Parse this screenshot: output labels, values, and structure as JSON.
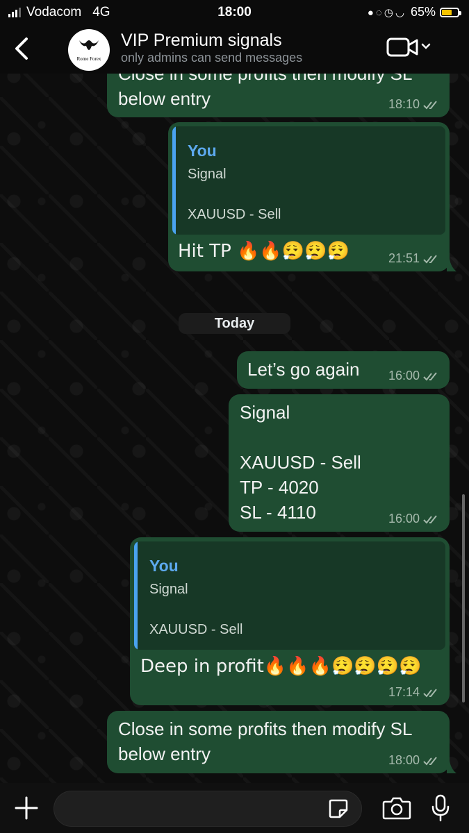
{
  "status_bar": {
    "carrier": "Vodacom",
    "network": "4G",
    "time": "18:00",
    "battery_percent": "65%",
    "battery_level": 0.65
  },
  "header": {
    "title": "VIP Premium signals",
    "subtitle": "only admins can send messages",
    "avatar_text": "Rome Forex"
  },
  "messages": [
    {
      "text": "Close in some profits then modify SL\nbelow entry",
      "time": "18:10"
    },
    {
      "quote_author": "You",
      "quote_line1": "Signal",
      "quote_line2": "XAUUSD - Sell",
      "text": "Hit TP 🔥🔥😮‍💨😮‍💨😮‍💨",
      "time": "21:51"
    },
    {
      "text": "Let’s go again",
      "time": "16:00"
    },
    {
      "text": "Signal\n\nXAUUSD - Sell\nTP - 4020\nSL - 4110",
      "time": "16:00"
    },
    {
      "quote_author": "You",
      "quote_line1": "Signal",
      "quote_line2": "XAUUSD - Sell",
      "text": "Deep in profit🔥🔥🔥😮‍💨😮‍💨😮‍💨😮‍💨",
      "time": "17:14"
    },
    {
      "text": "Close in some profits then modify SL\nbelow entry",
      "time": "18:00"
    }
  ],
  "date_separator": "Today",
  "composer": {
    "placeholder": ""
  },
  "colors": {
    "bubble": "#1f4d32",
    "quote_accent": "#4aa3f0",
    "ticks": "#a5b9ac"
  }
}
